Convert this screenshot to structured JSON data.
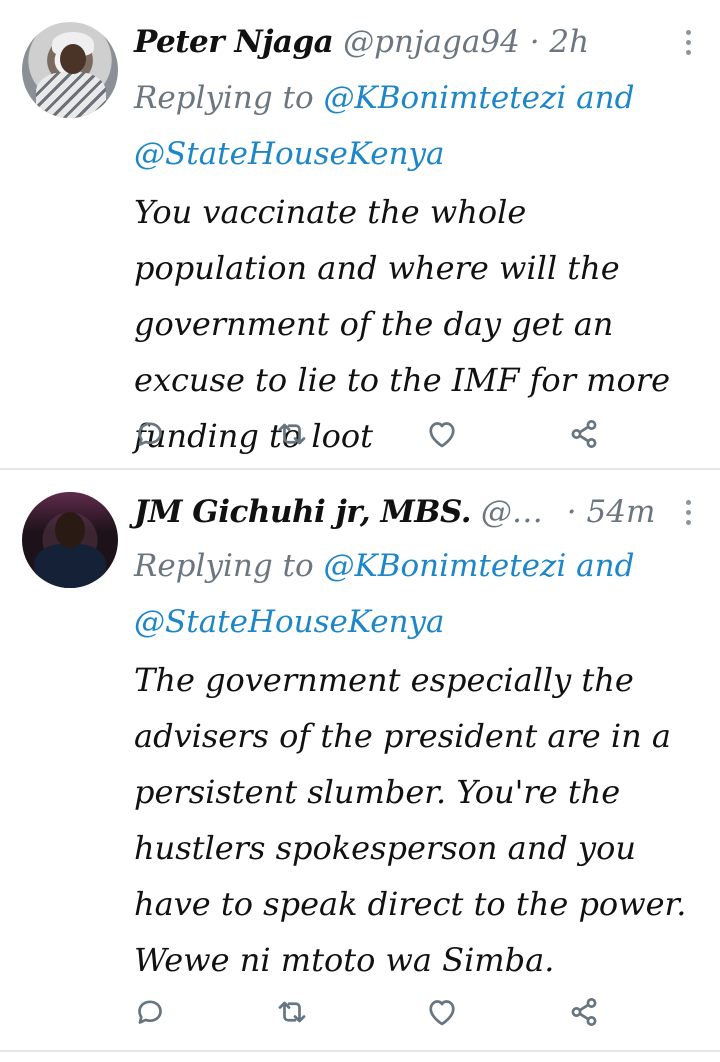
{
  "tweets": [
    {
      "name": "Peter Njaga",
      "handle": "@pnjaga94",
      "separator": "·",
      "time": "2h",
      "replying_prefix": "Replying to",
      "mention1": "@KBonimtetezi",
      "and": "and",
      "mention2": "@StateHouseKenya",
      "text": "You vaccinate the whole population and where will the government of the day get an excuse to lie to the IMF for more funding to loot"
    },
    {
      "name": "JM Gichuhi jr, MBS.",
      "handle": "@…",
      "separator": "·",
      "time": "54m",
      "replying_prefix": "Replying to",
      "mention1": "@KBonimtetezi",
      "and": "and",
      "mention2": "@StateHouseKenya",
      "text": "The government especially the advisers of the president are in a persistent slumber. You're the hustlers spokesperson and you have to speak direct to the power. Wewe ni mtoto wa Simba."
    }
  ],
  "icons": {
    "reply": "reply-icon",
    "retweet": "retweet-icon",
    "like": "like-icon",
    "share": "share-icon",
    "more": "more-options-icon"
  },
  "colors": {
    "mention": "#1d86c8",
    "muted": "#6b7680",
    "icon": "#66757f"
  }
}
